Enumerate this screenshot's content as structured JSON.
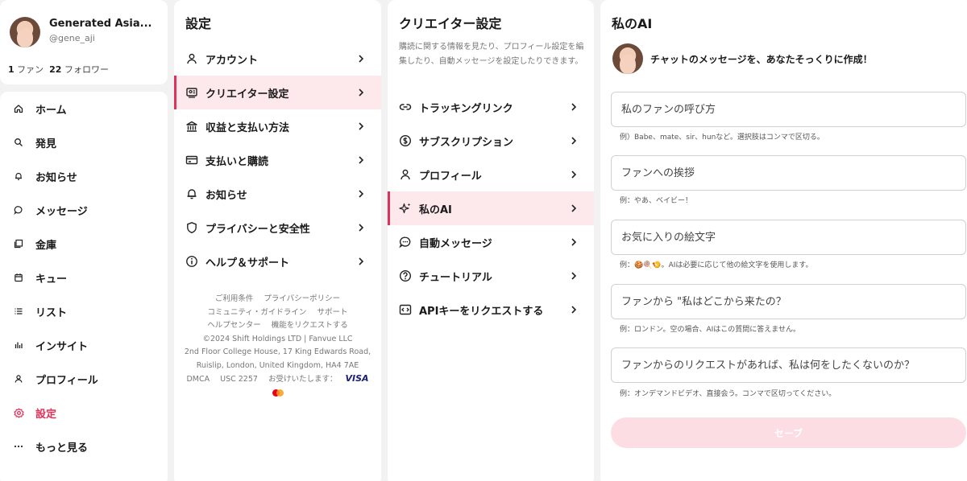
{
  "profile": {
    "name": "Generated Asia...",
    "handle": "@gene_aji",
    "fans_count": "1",
    "fans_label": "ファン",
    "followers_count": "22",
    "followers_label": "フォロワー"
  },
  "nav": {
    "items": [
      {
        "label": "ホーム",
        "icon": "home-icon"
      },
      {
        "label": "発見",
        "icon": "search-icon"
      },
      {
        "label": "お知らせ",
        "icon": "bell-icon"
      },
      {
        "label": "メッセージ",
        "icon": "chat-icon"
      },
      {
        "label": "金庫",
        "icon": "vault-icon"
      },
      {
        "label": "キュー",
        "icon": "calendar-icon"
      },
      {
        "label": "リスト",
        "icon": "list-icon"
      },
      {
        "label": "インサイト",
        "icon": "bar-chart-icon"
      },
      {
        "label": "プロフィール",
        "icon": "user-icon"
      },
      {
        "label": "設定",
        "icon": "gear-icon",
        "active": true
      },
      {
        "label": "もっと見る",
        "icon": "more-icon"
      }
    ]
  },
  "settings": {
    "title": "設定",
    "items": [
      {
        "label": "アカウント",
        "icon": "user-icon"
      },
      {
        "label": "クリエイター設定",
        "icon": "creator-icon",
        "active": true
      },
      {
        "label": "収益と支払い方法",
        "icon": "bank-icon"
      },
      {
        "label": "支払いと購読",
        "icon": "card-icon"
      },
      {
        "label": "お知らせ",
        "icon": "bell-icon"
      },
      {
        "label": "プライバシーと安全性",
        "icon": "shield-icon"
      },
      {
        "label": "ヘルプ＆サポート",
        "icon": "info-icon"
      }
    ],
    "footer": {
      "terms": "ご利用条件",
      "privacy": "プライバシーポリシー",
      "community": "コミュニティ・ガイドライン",
      "support": "サポート",
      "help_center": "ヘルプセンター",
      "feature_request": "機能をリクエストする",
      "copyright": "©2024 Shift Holdings LTD | Fanvue LLC",
      "address1": "2nd Floor College House, 17 King Edwards Road,",
      "address2": "Ruislip, London, United Kingdom, HA4 7AE",
      "dmca": "DMCA",
      "usc": "USC 2257",
      "accept": "お受けいたします：",
      "visa": "VISA"
    }
  },
  "creator": {
    "title": "クリエイター設定",
    "description": "購読に関する情報を見たり、プロフィール設定を編集したり、自動メッセージを設定したりできます。",
    "items": [
      {
        "label": "トラッキングリンク",
        "icon": "link-icon"
      },
      {
        "label": "サブスクリプション",
        "icon": "dollar-icon"
      },
      {
        "label": "プロフィール",
        "icon": "user-icon"
      },
      {
        "label": "私のAI",
        "icon": "sparkle-icon",
        "active": true
      },
      {
        "label": "自動メッセージ",
        "icon": "chat-icon"
      },
      {
        "label": "チュートリアル",
        "icon": "question-icon"
      },
      {
        "label": "APIキーをリクエストする",
        "icon": "code-icon"
      }
    ]
  },
  "ai": {
    "title": "私のAI",
    "tagline": "チャットのメッセージを、あなたそっくりに作成！",
    "fields": [
      {
        "placeholder": "私のファンの呼び方",
        "hint": "例）Babe、mate、sir、hunなど。選択肢はコンマで区切る。"
      },
      {
        "placeholder": "ファンへの挨拶",
        "hint": "例：やあ、ベイビー！"
      },
      {
        "placeholder": "お気に入りの絵文字",
        "hint": "例：🍪🍭🍤。AIは必要に応じて他の絵文字を使用します。"
      },
      {
        "placeholder": "ファンから \"私はどこから来たの？",
        "hint": "例：ロンドン。空の場合、AIはこの質問に答えません。"
      },
      {
        "placeholder": "ファンからのリクエストがあれば、私は何をしたくないのか？",
        "hint": "例：オンデマンドビデオ、直接会う。コンマで区切ってください。"
      }
    ],
    "save_label": "セーブ"
  },
  "colors": {
    "accent": "#e0315a",
    "active_bg": "#fde8ec",
    "save_bg": "#fcdde3"
  }
}
